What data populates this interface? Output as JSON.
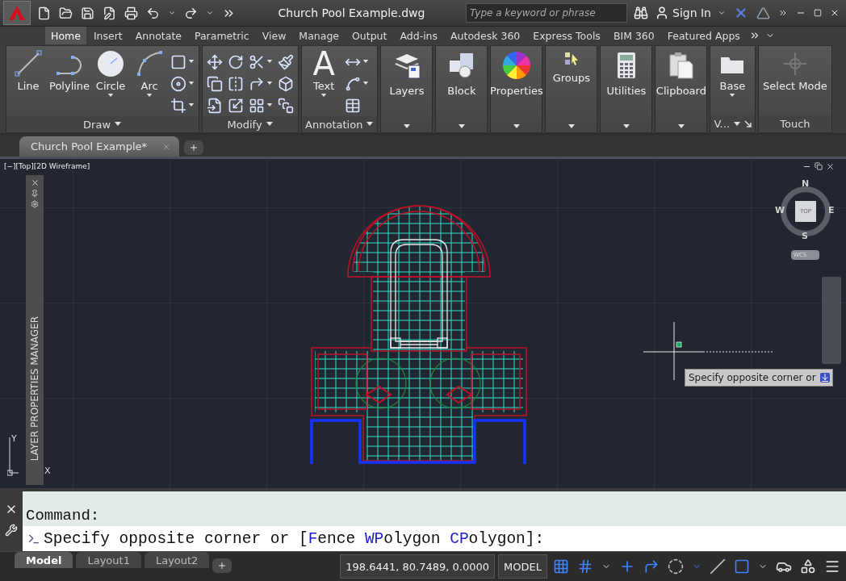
{
  "title_bar": {
    "title": "Church Pool Example.dwg",
    "search": {
      "placeholder": "Type a keyword or phrase"
    },
    "sign_in": "Sign In"
  },
  "ribbon_tabs": [
    {
      "label": "Home",
      "selected": true
    },
    {
      "label": "Insert",
      "selected": false
    },
    {
      "label": "Annotate",
      "selected": false
    },
    {
      "label": "Parametric",
      "selected": false
    },
    {
      "label": "View",
      "selected": false
    },
    {
      "label": "Manage",
      "selected": false
    },
    {
      "label": "Output",
      "selected": false
    },
    {
      "label": "Add-ins",
      "selected": false
    },
    {
      "label": "Autodesk 360",
      "selected": false
    },
    {
      "label": "Express Tools",
      "selected": false
    },
    {
      "label": "BIM 360",
      "selected": false
    },
    {
      "label": "Featured Apps",
      "selected": false
    }
  ],
  "ribbon_panels": [
    {
      "kind": "tools",
      "title": "Draw",
      "menu": true,
      "tools": [
        {
          "kind": "line",
          "label": "Line",
          "dropdown": false
        },
        {
          "kind": "polyline",
          "label": "Polyline",
          "dropdown": false
        },
        {
          "kind": "circle",
          "label": "Circle",
          "dropdown": true
        },
        {
          "kind": "arc",
          "label": "Arc",
          "dropdown": true
        }
      ],
      "small_tools": [
        {
          "dropdown": true
        },
        {
          "dropdown": true
        },
        {
          "dropdown": true
        }
      ]
    },
    {
      "kind": "tools",
      "title": "Modify",
      "menu": true,
      "small_tools": [
        {
          "dropdown": false
        },
        {
          "dropdown": false
        },
        {
          "dropdown": false
        },
        {
          "dropdown": false
        },
        {
          "dropdown": false
        },
        {
          "dropdown": false
        },
        {
          "dropdown": true
        },
        {
          "dropdown": true
        },
        {
          "dropdown": true
        },
        {
          "dropdown": false
        },
        {
          "dropdown": false
        },
        {
          "dropdown": false
        }
      ]
    },
    {
      "kind": "tools",
      "title": "Annotation",
      "menu": true,
      "tools": [
        {
          "kind": "text",
          "glyph": "A",
          "label": "Text",
          "dropdown": true
        }
      ],
      "small_tools": [
        {
          "dropdown": true
        },
        {
          "dropdown": true
        },
        {
          "dropdown": false
        }
      ]
    },
    {
      "kind": "collapsed",
      "title": "Layers"
    },
    {
      "kind": "collapsed",
      "title": "Block"
    },
    {
      "kind": "collapsed",
      "title": "Properties"
    },
    {
      "kind": "collapsed",
      "title": "Groups"
    },
    {
      "kind": "collapsed",
      "title": "Utilities"
    },
    {
      "kind": "collapsed",
      "title": "Clipboard"
    },
    {
      "kind": "tools",
      "title": "V...",
      "menu": true,
      "launcher": true,
      "tools": [
        {
          "kind": "base",
          "label": "Base",
          "dropdown": true
        }
      ]
    },
    {
      "kind": "tools",
      "title": "Touch",
      "menu": false,
      "tools": [
        {
          "kind": "select",
          "label": "Select Mode",
          "dropdown": false
        }
      ]
    }
  ],
  "file_tabs": [
    {
      "label": "Church Pool Example*",
      "selected": true
    }
  ],
  "viewport": {
    "label": "[−][Top][2D Wireframe]",
    "palette_title": "LAYER PROPERTIES MANAGER",
    "viewcube": {
      "north": "N",
      "south": "S",
      "east": "E",
      "west": "W",
      "face": "TOP",
      "ucs": "WCS"
    },
    "ucs_icon": {
      "y": "Y",
      "x": "X"
    },
    "tooltip": "Specify opposite corner or"
  },
  "command_line": {
    "history": "Command:",
    "prompt": [
      {
        "kind": "plain",
        "text": "Specify opposite corner or ["
      },
      {
        "kind": "key",
        "text": "F"
      },
      {
        "kind": "plain",
        "text": "ence "
      },
      {
        "kind": "key",
        "text": "WP"
      },
      {
        "kind": "plain",
        "text": "olygon "
      },
      {
        "kind": "key",
        "text": "CP"
      },
      {
        "kind": "plain",
        "text": "olygon]:"
      }
    ]
  },
  "status_bar": {
    "layout_tabs": [
      {
        "label": "Model",
        "selected": true
      },
      {
        "label": "Layout1",
        "selected": false
      },
      {
        "label": "Layout2",
        "selected": false
      }
    ],
    "coordinates": "198.6441, 80.7489, 0.0000",
    "space": "MODEL"
  }
}
